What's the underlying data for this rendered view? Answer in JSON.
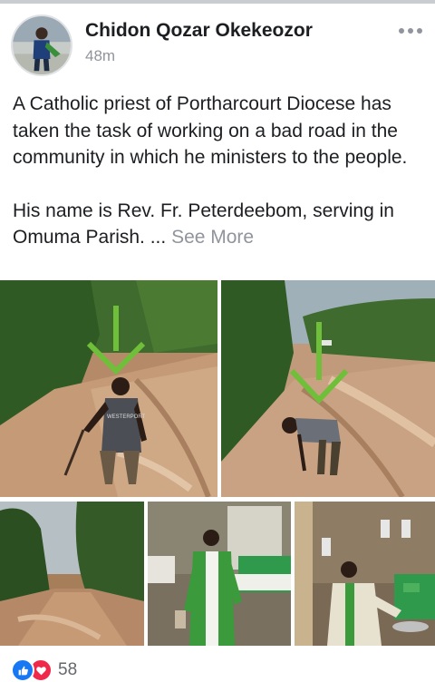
{
  "post": {
    "author": "Chidon Qozar Okekeozor",
    "time": "48m",
    "paragraph_1": "A Catholic priest of Portharcourt Diocese has taken the task of working on a bad road in the community in which he ministers to the people.",
    "paragraph_2_text": "His name is Rev. Fr. Peterdeebom, serving in Omuma Parish. ...",
    "see_more": "See More"
  },
  "photos": [
    {
      "name": "photo-priest-standing-road",
      "shirt_text": "WESTERPORT",
      "accent": "#6fbf3a"
    },
    {
      "name": "photo-priest-bending-road",
      "accent": "#6fbf3a"
    },
    {
      "name": "photo-muddy-road"
    },
    {
      "name": "photo-priest-altar-green-vestment"
    },
    {
      "name": "photo-priest-church-interior"
    }
  ],
  "reactions": {
    "icons": [
      "like-icon",
      "love-icon"
    ],
    "count": "58"
  },
  "colors": {
    "text": "#1c1e21",
    "muted": "#90949c",
    "like": "#1877f2",
    "love": "#f02849"
  }
}
